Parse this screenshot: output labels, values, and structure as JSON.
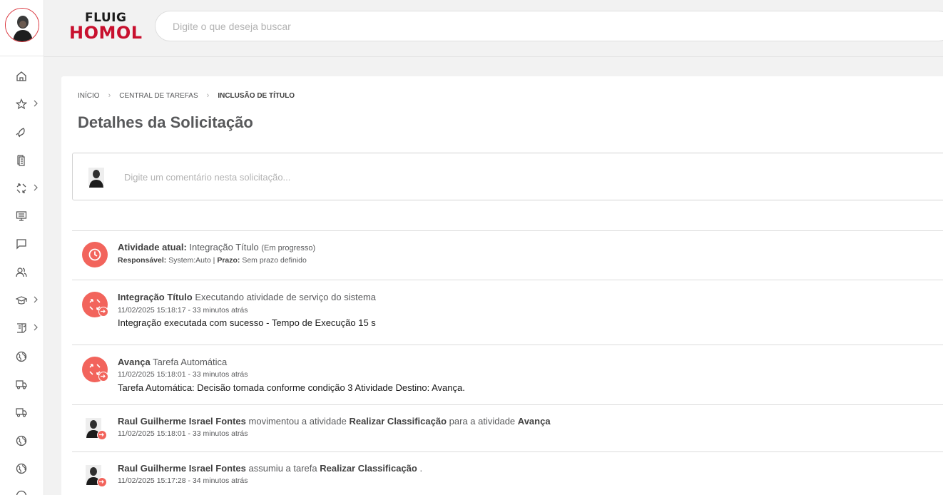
{
  "brand": {
    "line1": "FLUIG",
    "line2": "HOMOL"
  },
  "search": {
    "placeholder": "Digite o que deseja buscar"
  },
  "sidebar": {
    "avatar": "user-avatar",
    "items": [
      {
        "icon": "home-icon",
        "has_submenu": false
      },
      {
        "icon": "star-icon",
        "has_submenu": true
      },
      {
        "icon": "rocket-icon",
        "has_submenu": false
      },
      {
        "icon": "documents-icon",
        "has_submenu": false
      },
      {
        "icon": "workflow-icon",
        "has_submenu": true
      },
      {
        "icon": "monitor-icon",
        "has_submenu": false
      },
      {
        "icon": "chat-icon",
        "has_submenu": false
      },
      {
        "icon": "users-icon",
        "has_submenu": false
      },
      {
        "icon": "graduation-cap-icon",
        "has_submenu": true
      },
      {
        "icon": "task-list-icon",
        "has_submenu": true
      },
      {
        "icon": "globe-icon",
        "has_submenu": false
      },
      {
        "icon": "truck-icon",
        "has_submenu": false
      },
      {
        "icon": "truck-icon",
        "has_submenu": false
      },
      {
        "icon": "globe-icon",
        "has_submenu": false
      },
      {
        "icon": "globe-icon",
        "has_submenu": false
      }
    ]
  },
  "breadcrumb": {
    "home": "Início",
    "middle": "Central de Tarefas",
    "current": "Inclusão de Título"
  },
  "page_title": "Detalhes da Solicitação",
  "comment": {
    "placeholder": "Digite um comentário nesta solicitação..."
  },
  "current_activity": {
    "label": "Atividade atual:",
    "name": "Integração Título",
    "status": "(Em progresso)",
    "responsible_label": "Responsável:",
    "responsible": "System:Auto",
    "separator": "|",
    "deadline_label": "Prazo:",
    "deadline": "Sem prazo definido"
  },
  "feed": [
    {
      "title": "Integração Título",
      "desc": "Executando atividade de serviço do sistema",
      "time": "11/02/2025 15:18:17 - 33 minutos atrás",
      "message": "Integração executada com sucesso - Tempo de Execução 15 s"
    },
    {
      "title": "Avança",
      "desc": "Tarefa Automática",
      "time": "11/02/2025 15:18:01 - 33 minutos atrás",
      "message": "Tarefa Automática: Decisão tomada conforme condição 3 Atividade Destino: Avança."
    },
    {
      "user": "Raul Guilherme Israel Fontes",
      "verb": "movimentou a atividade",
      "from": "Realizar Classificação",
      "mid": "para a atividade",
      "to": "Avança",
      "time": "11/02/2025 15:18:01 - 33 minutos atrás"
    },
    {
      "user": "Raul Guilherme Israel Fontes",
      "verb": "assumiu a tarefa",
      "task": "Realizar Classificação",
      "end": ".",
      "time": "11/02/2025 15:17:28 - 34 minutos atrás"
    }
  ],
  "colors": {
    "accent": "#f2645c",
    "brand_red": "#c8102e",
    "text": "#58595b"
  }
}
